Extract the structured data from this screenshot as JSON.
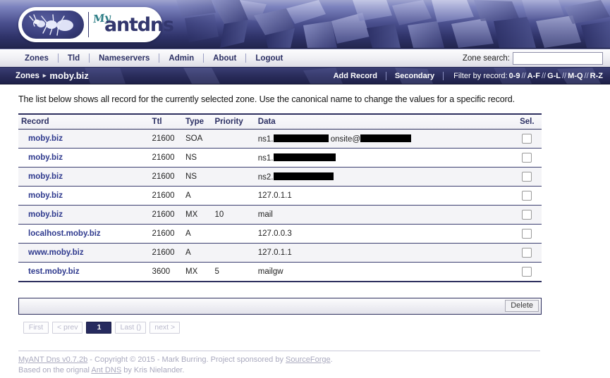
{
  "brand": {
    "logo_my": "My",
    "logo_word": "antdns",
    "ant_icon": "ant-icon"
  },
  "nav": {
    "items": [
      {
        "label": "Zones"
      },
      {
        "label": "Tld"
      },
      {
        "label": "Nameservers"
      },
      {
        "label": "Admin"
      },
      {
        "label": "About"
      },
      {
        "label": "Logout"
      }
    ],
    "search_label": "Zone search:",
    "search_value": "",
    "search_placeholder": ""
  },
  "breadcrumb": {
    "parent": "Zones",
    "separator": "▸",
    "current": "moby.biz"
  },
  "toolbar": {
    "add_record": "Add Record",
    "secondary": "Secondary",
    "filter_label": "Filter by record:",
    "filters": [
      "0-9",
      "A-F",
      "G-L",
      "M-Q",
      "R-Z"
    ],
    "filter_sep": "//"
  },
  "main": {
    "intro": "The list below shows all record for the currently selected zone. Use the canonical name to change the values for a specific record.",
    "columns": [
      "Record",
      "Ttl",
      "Type",
      "Priority",
      "Data",
      "Sel."
    ],
    "rows": [
      {
        "record": "moby.biz",
        "ttl": "21600",
        "type": "SOA",
        "priority": "",
        "data_prefix": "ns1.",
        "data_redacted": true,
        "redact_w": 78,
        "data_mid": "onsite@",
        "redact2_w": 72,
        "data_suffix": "",
        "selected": false
      },
      {
        "record": "moby.biz",
        "ttl": "21600",
        "type": "NS",
        "priority": "",
        "data_prefix": "ns1.",
        "data_redacted": true,
        "redact_w": 88,
        "data_mid": "",
        "redact2_w": 0,
        "data_suffix": "",
        "selected": false
      },
      {
        "record": "moby.biz",
        "ttl": "21600",
        "type": "NS",
        "priority": "",
        "data_prefix": "ns2.",
        "data_redacted": true,
        "redact_w": 85,
        "data_mid": "",
        "redact2_w": 0,
        "data_suffix": "",
        "selected": false
      },
      {
        "record": "moby.biz",
        "ttl": "21600",
        "type": "A",
        "priority": "",
        "data_prefix": "127.0.1.1",
        "data_redacted": false,
        "redact_w": 0,
        "data_mid": "",
        "redact2_w": 0,
        "data_suffix": "",
        "selected": false
      },
      {
        "record": "moby.biz",
        "ttl": "21600",
        "type": "MX",
        "priority": "10",
        "data_prefix": "mail",
        "data_redacted": false,
        "redact_w": 0,
        "data_mid": "",
        "redact2_w": 0,
        "data_suffix": "",
        "selected": false
      },
      {
        "record": "localhost.moby.biz",
        "ttl": "21600",
        "type": "A",
        "priority": "",
        "data_prefix": "127.0.0.3",
        "data_redacted": false,
        "redact_w": 0,
        "data_mid": "",
        "redact2_w": 0,
        "data_suffix": "",
        "selected": false
      },
      {
        "record": "www.moby.biz",
        "ttl": "21600",
        "type": "A",
        "priority": "",
        "data_prefix": "127.0.1.1",
        "data_redacted": false,
        "redact_w": 0,
        "data_mid": "",
        "redact2_w": 0,
        "data_suffix": "",
        "selected": false
      },
      {
        "record": "test.moby.biz",
        "ttl": "3600",
        "type": "MX",
        "priority": "5",
        "data_prefix": "mailgw",
        "data_redacted": false,
        "redact_w": 0,
        "data_mid": "",
        "redact2_w": 0,
        "data_suffix": "",
        "selected": false
      }
    ]
  },
  "actions": {
    "delete_label": "Delete"
  },
  "pagination": {
    "first": "First",
    "prev": "< prev",
    "current": "1",
    "last": "Last ()",
    "next": "next >"
  },
  "footer": {
    "app_link": "MyANT Dns v0.7.2b",
    "copy_text": " - Copyright © 2015 - Mark Burring. Project sponsored by ",
    "sponsor_link": "SourceForge",
    "copy_end": ".",
    "line2_prefix": "Based on the orignal ",
    "orig_link": "Ant DNS",
    "line2_suffix": " by Kris Nielander."
  },
  "colors": {
    "banner_dark": "#23264f",
    "banner_light": "#9fa4cf",
    "accent_navy": "#2b2f63",
    "link_blue": "#2f3a8e",
    "row_alt": "#f4f4f7",
    "footer_grey": "#a9a9be"
  }
}
